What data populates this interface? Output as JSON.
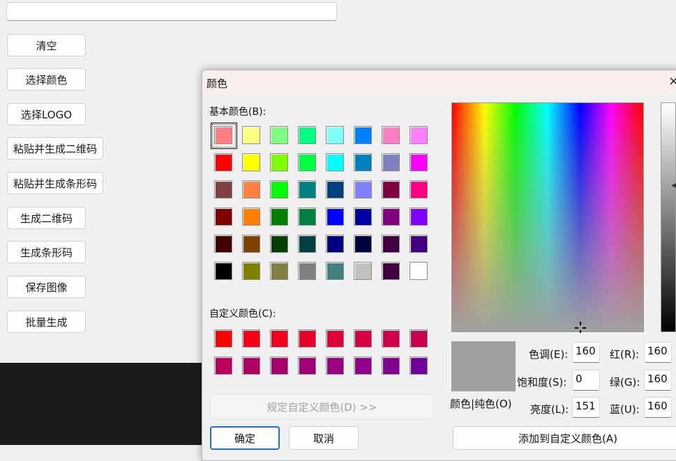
{
  "app": {
    "url_value": "",
    "buttons": [
      "清空",
      "选择颜色",
      "选择LOGO",
      "粘贴并生成二维码",
      "粘贴并生成条形码",
      "生成二维码",
      "生成条形码",
      "保存图像",
      "批量生成"
    ]
  },
  "dialog": {
    "title": "颜色",
    "close": "×",
    "basic_label": "基本颜色(B):",
    "custom_label": "自定义颜色(C):",
    "basic_colors": [
      "#ff8080",
      "#ffff80",
      "#80ff80",
      "#00ff80",
      "#80ffff",
      "#0080ff",
      "#ff80c0",
      "#ff80ff",
      "#ff0000",
      "#ffff00",
      "#80ff00",
      "#00ff40",
      "#00ffff",
      "#0080c0",
      "#8080c0",
      "#ff00ff",
      "#804040",
      "#ff8040",
      "#00ff00",
      "#008080",
      "#004080",
      "#8080ff",
      "#800040",
      "#ff0080",
      "#800000",
      "#ff8000",
      "#008000",
      "#008040",
      "#0000ff",
      "#0000a0",
      "#800080",
      "#8000ff",
      "#400000",
      "#804000",
      "#004000",
      "#004040",
      "#000080",
      "#000040",
      "#400040",
      "#400080",
      "#000000",
      "#808000",
      "#808040",
      "#808080",
      "#408080",
      "#c0c0c0",
      "#400040",
      "#ffffff"
    ],
    "custom_colors": [
      "#ff0000",
      "#f70015",
      "#ef0020",
      "#e8002a",
      "#e00035",
      "#d80040",
      "#d0004a",
      "#c80050",
      "#b8005a",
      "#b00062",
      "#a8006a",
      "#a00075",
      "#980080",
      "#90008a",
      "#800090",
      "#70009a"
    ],
    "define_custom_button": "规定自定义颜色(D) >>",
    "ok_button": "确定",
    "cancel_button": "取消",
    "add_custom_button": "添加到自定义颜色(A)",
    "preview_label": "颜色|纯色(O)",
    "preview_color": "#a0a0a0",
    "hue_label": "色调(E):",
    "hue_value": "160",
    "sat_label": "饱和度(S):",
    "sat_value": "0",
    "lum_label": "亮度(L):",
    "lum_value": "151",
    "red_label": "红(R):",
    "red_value": "160",
    "green_label": "绿(G):",
    "green_value": "160",
    "blue_label": "蓝(U):",
    "blue_value": "160"
  }
}
